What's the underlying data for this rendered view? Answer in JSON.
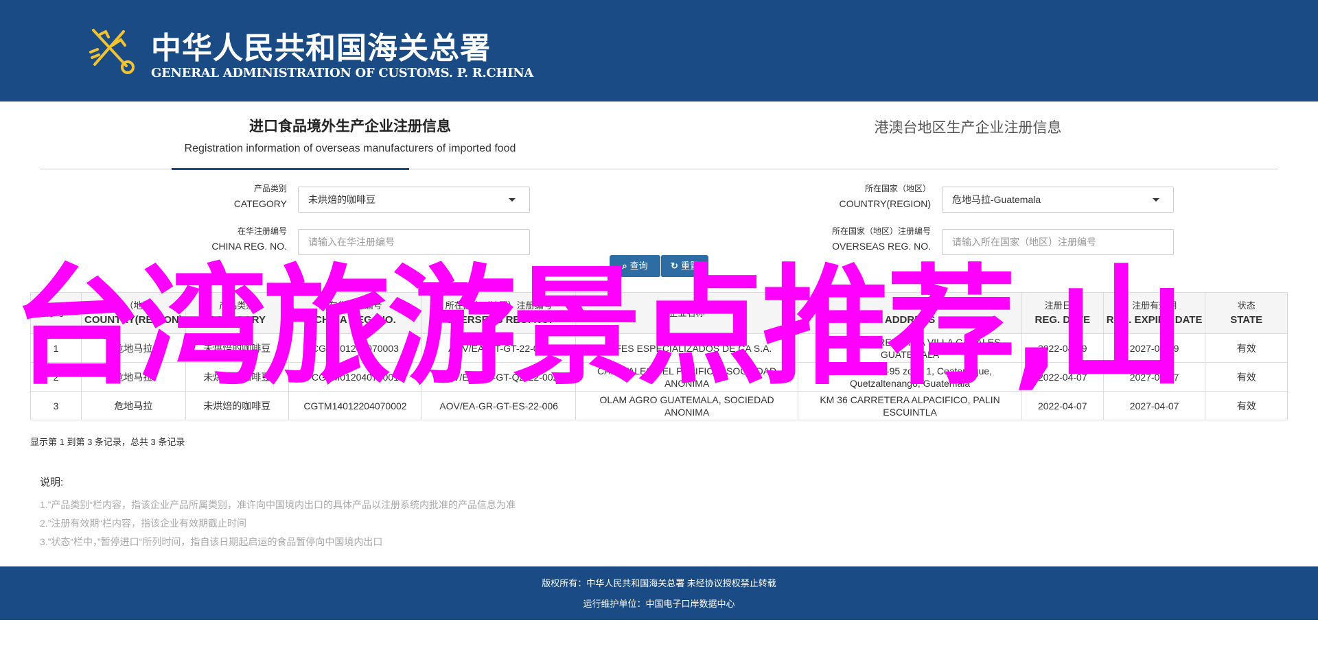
{
  "header": {
    "title_cn": "中华人民共和国海关总署",
    "title_en": "GENERAL ADMINISTRATION OF CUSTOMS. P. R.CHINA",
    "bg_color": "#1b4b84"
  },
  "tabs": [
    {
      "label_cn": "进口食品境外生产企业注册信息",
      "label_en": "Registration information of overseas manufacturers of imported food",
      "active": true
    },
    {
      "label_cn": "港澳台地区生产企业注册信息",
      "active": false
    }
  ],
  "form": {
    "category": {
      "label_cn": "产品类别",
      "label_en": "CATEGORY",
      "value": "未烘焙的咖啡豆"
    },
    "country": {
      "label_cn": "所在国家（地区）",
      "label_en": "COUNTRY(REGION)",
      "value": "危地马拉-Guatemala"
    },
    "china_reg": {
      "label_cn": "在华注册编号",
      "label_en": "CHINA REG. NO.",
      "placeholder": "请输入在华注册编号"
    },
    "overseas_reg": {
      "label_cn": "所在国家（地区）注册编号",
      "label_en": "OVERSEAS REG. NO.",
      "placeholder": "请输入所在国家（地区）注册编号"
    },
    "search_button": "查询",
    "reset_button": "重置"
  },
  "table": {
    "headers": [
      {
        "cn": "序号",
        "en": ""
      },
      {
        "cn": "国家（地区）",
        "en": "COUNTRY(REGION)"
      },
      {
        "cn": "产品类别",
        "en": "CATEGORY"
      },
      {
        "cn": "在华注册编号",
        "en": "CHINA REG. NO."
      },
      {
        "cn": "所在国家（地区）注册编号",
        "en": "OVERSEAS REG. NO."
      },
      {
        "cn": "企业名称",
        "en": ""
      },
      {
        "cn": "企业地址",
        "en": "ADDRESS"
      },
      {
        "cn": "注册日期",
        "en": "REG. DATE"
      },
      {
        "cn": "注册有效期",
        "en": "REG. EXPIRE DATE"
      },
      {
        "cn": "状态",
        "en": "STATE"
      }
    ],
    "rows": [
      [
        "1",
        "危地马拉",
        "未烘焙的咖啡豆",
        "CGTM01204070003",
        "AOV/EA-GT-GT-22-010",
        "CAFES ESPECIALIZADOS DE CA S.A.",
        "KM 27.5 CARRETERA A VILLA CANALES GUATEMALA",
        "2022-04-19",
        "2027-04-19",
        "有效"
      ],
      [
        "2",
        "危地马拉",
        "未烘焙的咖啡豆",
        "CGTM01204070001",
        "AOV/EA-GR-GT-QZ-22-002",
        "CAFETALES DEL PACIFICO, SOCIEDAD ANONIMA",
        "la calle final 2-95 zona 1, Coatepeque, Quetzaltenango, Guatemala",
        "2022-04-07",
        "2027-04-07",
        "有效"
      ],
      [
        "3",
        "危地马拉",
        "未烘焙的咖啡豆",
        "CGTM14012204070002",
        "AOV/EA-GR-GT-ES-22-006",
        "OLAM AGRO GUATEMALA, SOCIEDAD ANONIMA",
        "KM 36 CARRETERA ALPACIFICO, PALIN ESCUINTLA",
        "2022-04-07",
        "2027-04-07",
        "有效"
      ]
    ]
  },
  "summary": "显示第 1 到第 3 条记录，总共 3 条记录",
  "notes": {
    "title": "说明:",
    "items": [
      "1.”产品类别“栏内容，指该企业产品所属类别，准许向中国境内出口的具体产品以注册系统内批准的产品信息为准",
      "2.”注册有效期“栏内容，指该企业有效期截止时间",
      "3.”状态“栏中，”暂停进口“所列时间，指自该日期起启运的食品暂停向中国境内出口"
    ]
  },
  "footer": {
    "line1": "版权所有：中华人民共和国海关总署 未经协议授权禁止转载",
    "line2": "运行维护单位：中国电子口岸数据中心"
  },
  "overlay_text": "台湾旅游景点推荐,山",
  "colors": {
    "overlay": "#ff00ff",
    "button": "#2e6da4",
    "tab_underline": "#1b4b84"
  }
}
